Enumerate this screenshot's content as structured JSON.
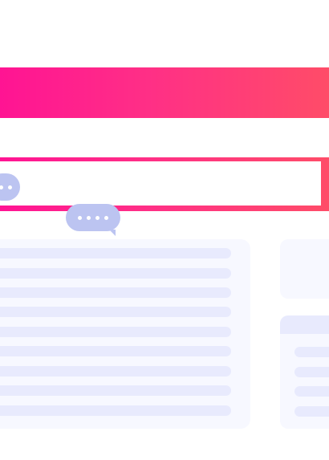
{
  "theme": {
    "gradient_start": "#ff1493",
    "gradient_end": "#ff4c68",
    "bubble_color": "#bcc4f1",
    "panel_color": "#f7f8ff",
    "placeholder_row_color": "#e8eafd"
  },
  "header": {
    "title": ""
  },
  "message_input": {
    "value": "",
    "placeholder": ""
  },
  "typing_indicators": [
    {
      "icon": "typing-dots-icon"
    },
    {
      "icon": "typing-dots-icon"
    }
  ],
  "list_panel": {
    "row_count": 9
  },
  "side_panel": {
    "bottom_card_row_count": 4
  }
}
